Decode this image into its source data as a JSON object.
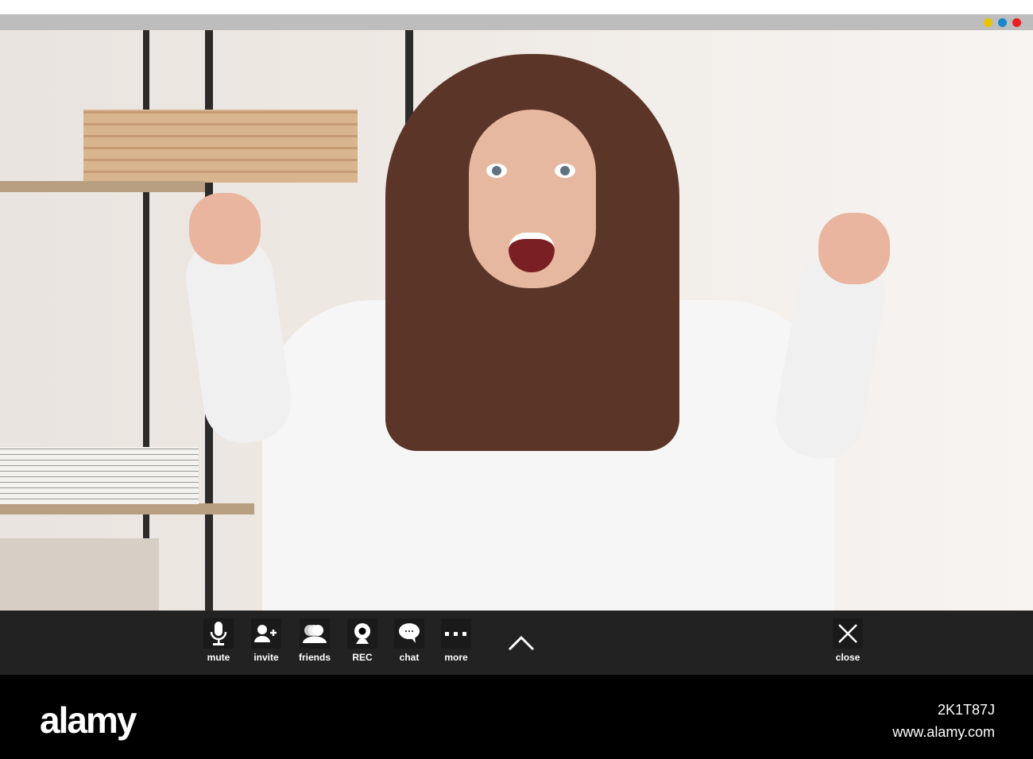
{
  "window": {
    "controls": [
      {
        "name": "minimize",
        "color": "#e8c400"
      },
      {
        "name": "maximize",
        "color": "#1a86d0"
      },
      {
        "name": "close",
        "color": "#ee1c24"
      }
    ]
  },
  "toolbar": {
    "buttons": [
      {
        "id": "mute",
        "label": "mute",
        "icon": "microphone-icon"
      },
      {
        "id": "invite",
        "label": "invite",
        "icon": "add-user-icon"
      },
      {
        "id": "friends",
        "label": "friends",
        "icon": "group-icon"
      },
      {
        "id": "rec",
        "label": "REC",
        "icon": "webcam-icon"
      },
      {
        "id": "chat",
        "label": "chat",
        "icon": "speech-bubble-icon"
      },
      {
        "id": "more",
        "label": "more",
        "icon": "ellipsis-icon"
      }
    ],
    "close_label": "close"
  },
  "watermark": {
    "logo": "alamy",
    "image_id": "2K1T87J",
    "site": "www.alamy.com"
  }
}
